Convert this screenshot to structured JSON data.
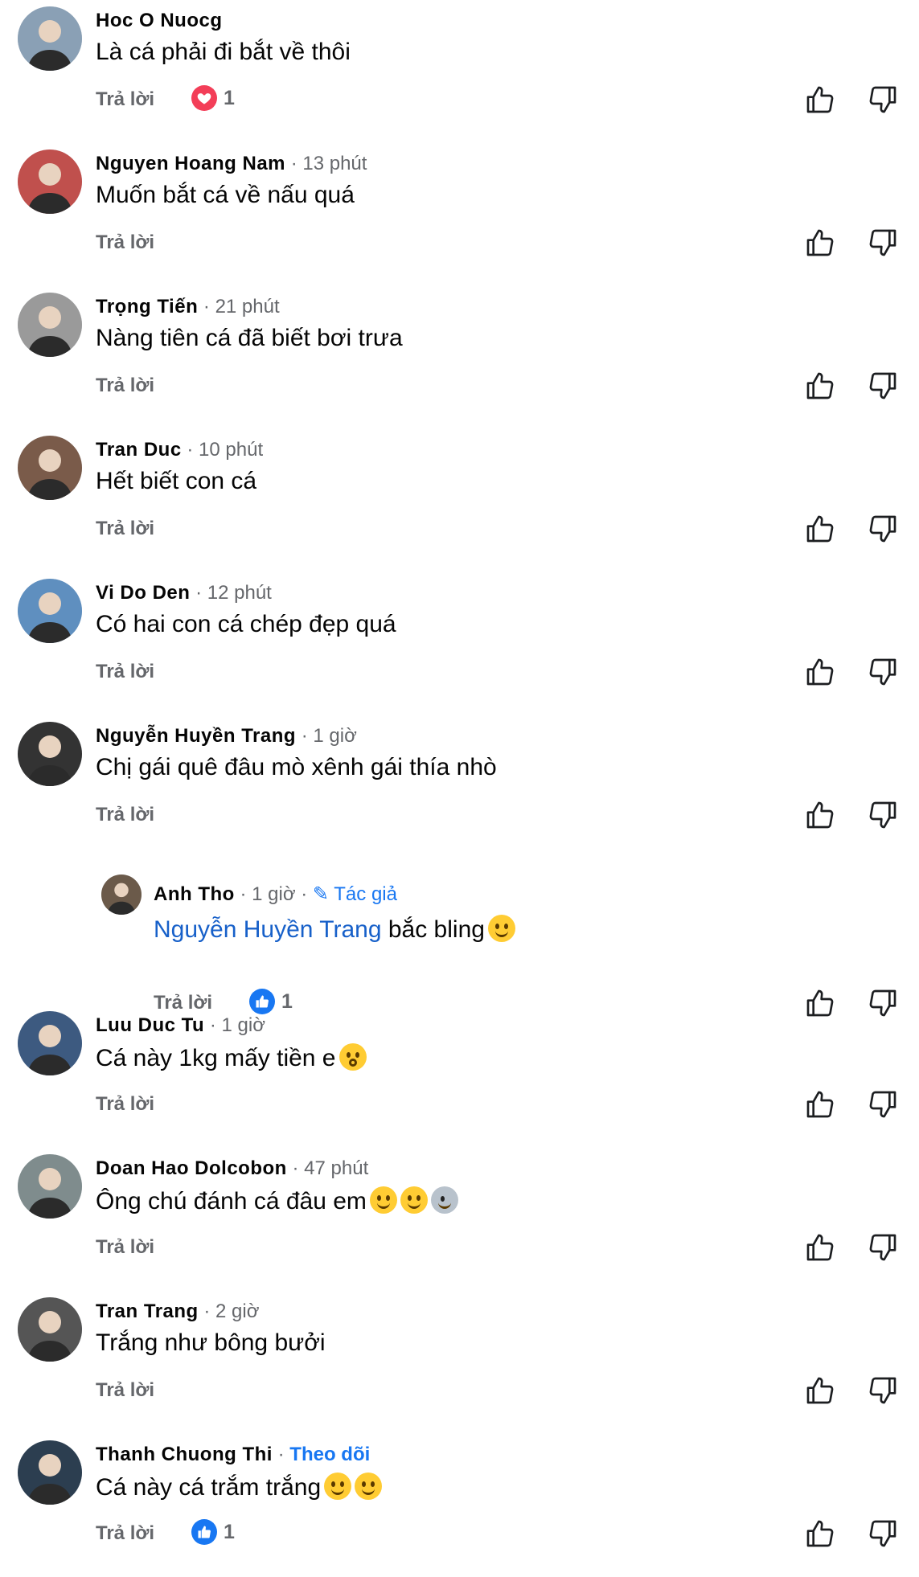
{
  "reply_label": "Trả lời",
  "colors": {
    "accent": "#1877f2",
    "heart": "#f33e58",
    "muted": "#65676b"
  },
  "comments": [
    {
      "name": "Hoc O Nuocg",
      "meta": "",
      "text": "Là cá phải đi bắt về thôi",
      "reaction": {
        "type": "heart",
        "count": "1"
      }
    },
    {
      "name": "Nguyen Hoang Nam",
      "meta": "· 13 phút",
      "text": "Muốn bắt cá về nấu quá"
    },
    {
      "name": "Trọng Tiến",
      "meta": "· 21 phút",
      "text": "Nàng tiên cá đã biết bơi trưa"
    },
    {
      "name": "Tran Duc",
      "meta": "· 10 phút",
      "text": "Hết biết con cá"
    },
    {
      "name": "Vi Do Den",
      "meta": "· 12 phút",
      "text": "Có hai con cá chép đẹp quá"
    },
    {
      "name": "Nguyễn Huyền Trang",
      "meta": "· 1 giờ",
      "text": "Chị gái quê đâu mò xênh gái thía nhò"
    },
    {
      "name": "Anh Tho",
      "meta": "· 1 giờ ·",
      "author": "Tác giả",
      "mention": "Nguyễn Huyền Trang",
      "text": " bắc bling",
      "emojis": [
        "laugh"
      ],
      "reaction": {
        "type": "like",
        "count": "1"
      }
    },
    {
      "name": "Luu Duc Tu",
      "meta": "· 1 giờ",
      "text": "Cá này 1kg mấy tiền e",
      "emojis": [
        "wow"
      ]
    },
    {
      "name": "Doan Hao Dolcobon",
      "meta": "· 47 phút",
      "text": "Ông chú đánh cá đâu em",
      "emojis": [
        "shy",
        "shy",
        "bird"
      ]
    },
    {
      "name": "Tran Trang",
      "meta": "· 2 giờ",
      "text": "Trắng như bông bưởi"
    },
    {
      "name": "Thanh Chuong Thi",
      "meta": "·",
      "follow": "Theo dõi",
      "text": "Cá này cá trắm trắng",
      "emojis": [
        "grin",
        "laugh"
      ],
      "reaction": {
        "type": "like",
        "count": "1"
      }
    }
  ]
}
